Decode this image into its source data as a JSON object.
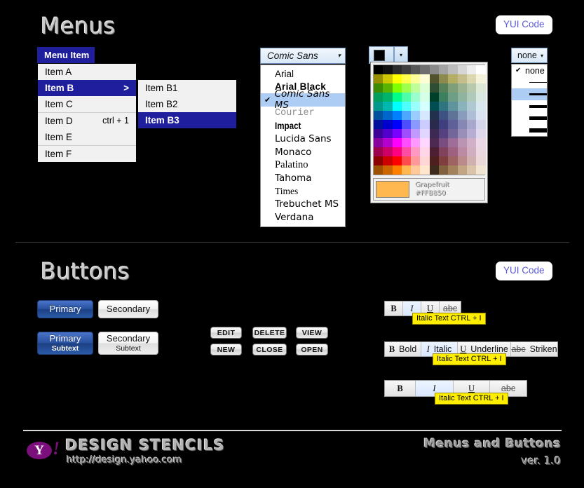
{
  "sections": {
    "menus": {
      "title": "Menus",
      "yui_label": "YUI Code"
    },
    "buttons": {
      "title": "Buttons",
      "yui_label": "YUI Code"
    }
  },
  "menu": {
    "bar_item": "Menu Item",
    "items": [
      {
        "label": "Item A",
        "shortcut": "",
        "arrow": "",
        "selected": false,
        "sep_after": false
      },
      {
        "label": "Item B",
        "shortcut": "",
        "arrow": ">",
        "selected": true,
        "sep_after": false
      },
      {
        "label": "Item C",
        "shortcut": "",
        "arrow": "",
        "selected": false,
        "sep_after": true
      },
      {
        "label": "Item D",
        "shortcut": "ctrl + 1",
        "arrow": "",
        "selected": false,
        "sep_after": false
      },
      {
        "label": "Item E",
        "shortcut": "",
        "arrow": "",
        "selected": false,
        "sep_after": true
      },
      {
        "label": "Item F",
        "shortcut": "",
        "arrow": "",
        "selected": false,
        "sep_after": false
      }
    ],
    "submenu": [
      {
        "label": "Item B1",
        "selected": false
      },
      {
        "label": "Item B2",
        "selected": false
      },
      {
        "label": "Item B3",
        "selected": true
      }
    ]
  },
  "font_select": {
    "value": "Comic Sans",
    "caret": "▾",
    "check": "✔",
    "options": [
      {
        "label": "Arial",
        "style": "f-arial",
        "selected": false
      },
      {
        "label": "Arial Black",
        "style": "f-arialblack",
        "selected": false
      },
      {
        "label": "Comic Sans MS",
        "style": "f-comic",
        "selected": true
      },
      {
        "label": "Courier",
        "style": "f-courier",
        "selected": false
      },
      {
        "label": "Impact",
        "style": "f-impact",
        "selected": false
      },
      {
        "label": "Lucida Sans",
        "style": "f-lucida",
        "selected": false
      },
      {
        "label": "Monaco",
        "style": "f-monaco",
        "selected": false
      },
      {
        "label": "Palatino",
        "style": "f-palatino",
        "selected": false
      },
      {
        "label": "Tahoma",
        "style": "f-tahoma",
        "selected": false
      },
      {
        "label": "Times",
        "style": "f-times",
        "selected": false
      },
      {
        "label": "Trebuchet MS",
        "style": "f-trebuchet",
        "selected": false
      },
      {
        "label": "Verdana",
        "style": "f-verdana",
        "selected": false
      }
    ]
  },
  "color_picker": {
    "current_swatch": "#000000",
    "caret": "▾",
    "selected_index": 147,
    "selected_name": "Grapefruit",
    "selected_hex": "#FFB850",
    "grid": [
      "#000000",
      "#111111",
      "#2d2d2d",
      "#3f3f3f",
      "#575757",
      "#6e6e6e",
      "#8a8a8a",
      "#a3a3a3",
      "#bcbcbc",
      "#d6d6d6",
      "#ededed",
      "#ffffff",
      "#978f00",
      "#cec700",
      "#ffff00",
      "#ffff4d",
      "#ffff99",
      "#ffffd6",
      "#51532e",
      "#8c8a4f",
      "#b3ae63",
      "#c5bd8b",
      "#ddd7b0",
      "#f5f2db",
      "#3d8c00",
      "#59b300",
      "#7fff00",
      "#9eff4d",
      "#bfff99",
      "#dcffd6",
      "#2f4d33",
      "#55805a",
      "#7f9e7a",
      "#9cb392",
      "#b9c9ae",
      "#dee8d6",
      "#009e5c",
      "#00b36b",
      "#00ff88",
      "#4dffab",
      "#99ffcc",
      "#d6ffe8",
      "#00402b",
      "#3d8060",
      "#6e9e85",
      "#90b3a0",
      "#afc9bb",
      "#d9e8e0",
      "#00998c",
      "#00b8b0",
      "#00ffff",
      "#4dffff",
      "#99ffff",
      "#d6ffff",
      "#004d52",
      "#2f7580",
      "#5f949e",
      "#8ab3bb",
      "#aec9d1",
      "#d9e8ed",
      "#00519e",
      "#0066cc",
      "#0080ff",
      "#4da6ff",
      "#99ccff",
      "#d6e8ff",
      "#22304d",
      "#3d5280",
      "#5f7399",
      "#8a9cbb",
      "#b0bdd6",
      "#dbe2f0",
      "#000f9e",
      "#0000cc",
      "#0000ff",
      "#4d4dff",
      "#8a99ff",
      "#ccccff",
      "#2a2a4d",
      "#3f3f80",
      "#606099",
      "#8787b3",
      "#a8a8cc",
      "#d6d6eb",
      "#3d0099",
      "#5200cc",
      "#7a00ff",
      "#9e4dff",
      "#c199ff",
      "#e0d6ff",
      "#3d2a52",
      "#554080",
      "#736699",
      "#9a8fb8",
      "#b8aed1",
      "#e0d9eb",
      "#8a009e",
      "#b300cc",
      "#ff00ff",
      "#ff4dff",
      "#ff99ff",
      "#ffd6ff",
      "#4d2a52",
      "#7a4d80",
      "#9e6e99",
      "#bb93b3",
      "#d1b0c9",
      "#ebd9e8",
      "#9e004d",
      "#cc0066",
      "#ff0080",
      "#ff4da6",
      "#ff99c4",
      "#ffd6e8",
      "#4d1f33",
      "#80425c",
      "#9e6180",
      "#bb8aa3",
      "#d1afc1",
      "#ebd9e2",
      "#8c0000",
      "#cc0000",
      "#ff0000",
      "#ff4d4d",
      "#ff9999",
      "#ffd6d6",
      "#4d1f1f",
      "#803f3f",
      "#9e6363",
      "#bb8a8a",
      "#d1b0b0",
      "#ebd9d9",
      "#9e5200",
      "#cc6600",
      "#ff8000",
      "#ffb850",
      "#ffc999",
      "#ffe6cc",
      "#3d2a1f",
      "#80603f",
      "#a3815c",
      "#c2a582",
      "#d9c4aa",
      "#f0e4d2"
    ]
  },
  "line_select": {
    "value": "none",
    "caret": "▾",
    "check": "✔",
    "none_label": "none",
    "options": [
      {
        "label": "none",
        "weight": 0,
        "selected": true,
        "highlighted": false
      },
      {
        "label": "",
        "weight": 1,
        "selected": false,
        "highlighted": false
      },
      {
        "label": "",
        "weight": 3,
        "selected": false,
        "highlighted": true
      },
      {
        "label": "",
        "weight": 4,
        "selected": false,
        "highlighted": false
      },
      {
        "label": "",
        "weight": 5,
        "selected": false,
        "highlighted": false
      },
      {
        "label": "",
        "weight": 6,
        "selected": false,
        "highlighted": false
      }
    ]
  },
  "main_buttons": [
    {
      "label": "Primary",
      "sub": "",
      "variant": "primary"
    },
    {
      "label": "Secondary",
      "sub": "",
      "variant": "secondary"
    },
    {
      "label": "Primary",
      "sub": "Subtext",
      "variant": "primary"
    },
    {
      "label": "Secondary",
      "sub": "Subtext",
      "variant": "secondary"
    }
  ],
  "small_buttons": [
    {
      "label": "EDIT"
    },
    {
      "label": "DELETE"
    },
    {
      "label": "VIEW"
    },
    {
      "label": "NEW"
    },
    {
      "label": "CLOSE"
    },
    {
      "label": "OPEN"
    }
  ],
  "toolbars": [
    {
      "tooltip": "Italic Text  CTRL + I",
      "buttons": [
        {
          "glyph": "B",
          "label": "",
          "state": "normal",
          "kind": "bold"
        },
        {
          "glyph": "I",
          "label": "",
          "state": "active",
          "kind": "italic"
        },
        {
          "glyph": "U",
          "label": "",
          "state": "normal",
          "kind": "underline"
        },
        {
          "glyph": "abc",
          "label": "",
          "state": "normal",
          "kind": "strike"
        }
      ]
    },
    {
      "tooltip": "Italic Text  CTRL + I",
      "buttons": [
        {
          "glyph": "B",
          "label": "Bold",
          "state": "normal",
          "kind": "bold"
        },
        {
          "glyph": "I",
          "label": "Italic",
          "state": "active",
          "kind": "italic"
        },
        {
          "glyph": "U",
          "label": "Underline",
          "state": "normal",
          "kind": "underline"
        },
        {
          "glyph": "abc",
          "label": "Striken",
          "state": "normal",
          "kind": "strike"
        }
      ]
    },
    {
      "tooltip": "Italic Text  CTRL + I",
      "buttons": [
        {
          "glyph": "B",
          "label": "",
          "state": "normal",
          "kind": "bold"
        },
        {
          "glyph": "I",
          "label": "",
          "state": "active",
          "kind": "italic"
        },
        {
          "glyph": "U",
          "label": "",
          "state": "normal",
          "kind": "underline"
        },
        {
          "glyph": "abc",
          "label": "",
          "state": "normal",
          "kind": "strike"
        }
      ]
    }
  ],
  "footer": {
    "logo_letter": "Y",
    "logo_bang": "!",
    "title": "DESIGN STENCILS",
    "url": "http://design.yahoo.com",
    "doc_title": "Menus and Buttons",
    "version": "ver. 1.0"
  }
}
